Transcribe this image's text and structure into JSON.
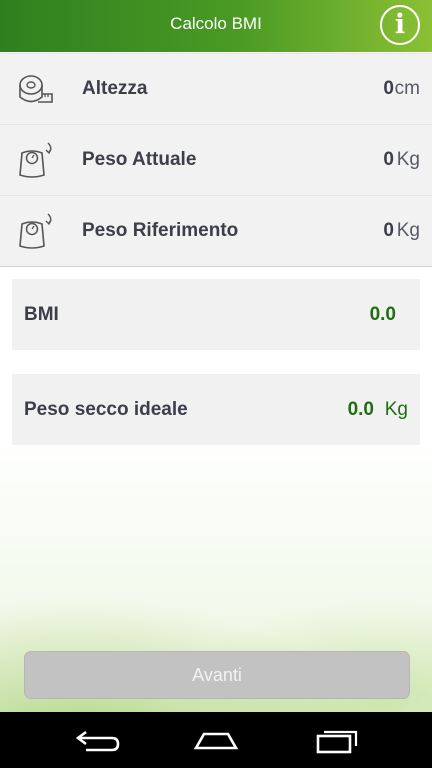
{
  "header": {
    "title": "Calcolo BMI",
    "info_icon": "info-icon",
    "info_glyph": "i"
  },
  "inputs": [
    {
      "icon": "tape-measure-icon",
      "label": "Altezza",
      "value": "0",
      "unit": "cm"
    },
    {
      "icon": "scale-icon",
      "label": "Peso Attuale",
      "value": "0",
      "unit": "Kg"
    },
    {
      "icon": "scale-icon",
      "label": "Peso Riferimento",
      "value": "0",
      "unit": "Kg"
    }
  ],
  "results": {
    "bmi": {
      "label": "BMI",
      "value": "0.0"
    },
    "ideal": {
      "label": "Peso secco ideale",
      "value": "0.0",
      "unit": "Kg"
    }
  },
  "footer": {
    "next_label": "Avanti"
  },
  "navbar": {
    "icons": [
      "back-icon",
      "home-icon",
      "recent-apps-icon"
    ]
  },
  "colors": {
    "accent": "#3f8f20",
    "result": "#1f6e12",
    "button_disabled": "#c2c2c2"
  }
}
